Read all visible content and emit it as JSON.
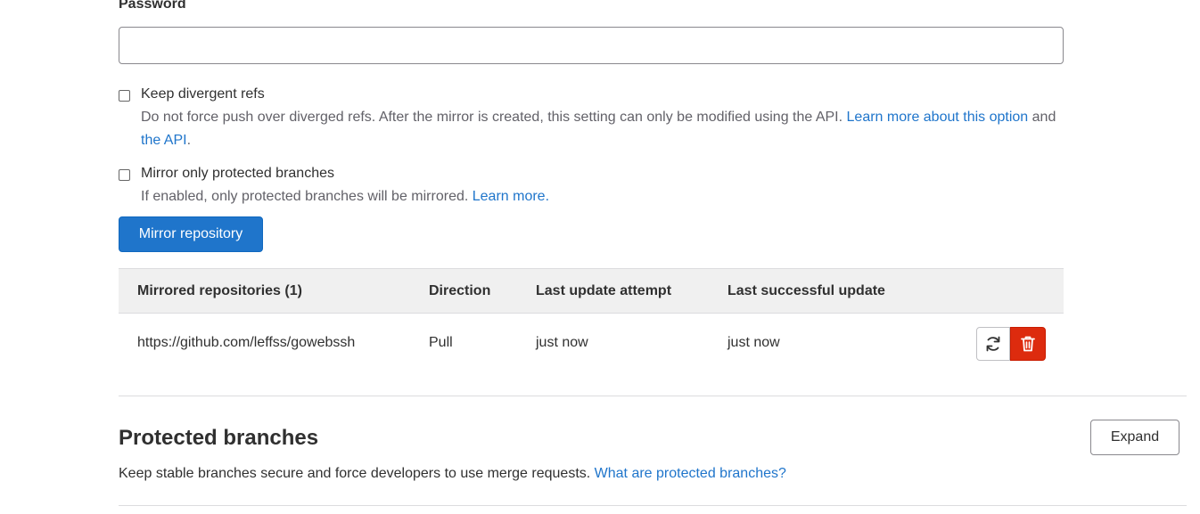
{
  "form": {
    "password_label": "Password",
    "password_value": "",
    "keep_divergent": {
      "label": "Keep divergent refs",
      "help_text": "Do not force push over diverged refs. After the mirror is created, this setting can only be modified using the API. ",
      "link1": "Learn more about this option",
      "and_text": " and ",
      "link2": "the API",
      "end_text": "."
    },
    "protected_only": {
      "label": "Mirror only protected branches",
      "help_text": "If enabled, only protected branches will be mirrored. ",
      "link": "Learn more."
    },
    "submit_label": "Mirror repository"
  },
  "mirrors_table": {
    "headers": {
      "repo": "Mirrored repositories (1)",
      "direction": "Direction",
      "last_attempt": "Last update attempt",
      "last_success": "Last successful update"
    },
    "rows": [
      {
        "url": "https://github.com/leffss/gowebssh",
        "direction": "Pull",
        "last_attempt": "just now",
        "last_success": "just now"
      }
    ],
    "icons": {
      "refresh": "refresh-icon",
      "delete": "trash-icon"
    }
  },
  "protected_branches": {
    "title": "Protected branches",
    "description": "Keep stable branches secure and force developers to use merge requests. ",
    "link": "What are protected branches?",
    "expand_label": "Expand"
  },
  "colors": {
    "primary": "#1f75cb",
    "danger": "#dd2b0e",
    "link": "#1f75cb",
    "header_bg": "#f0f0f0"
  }
}
